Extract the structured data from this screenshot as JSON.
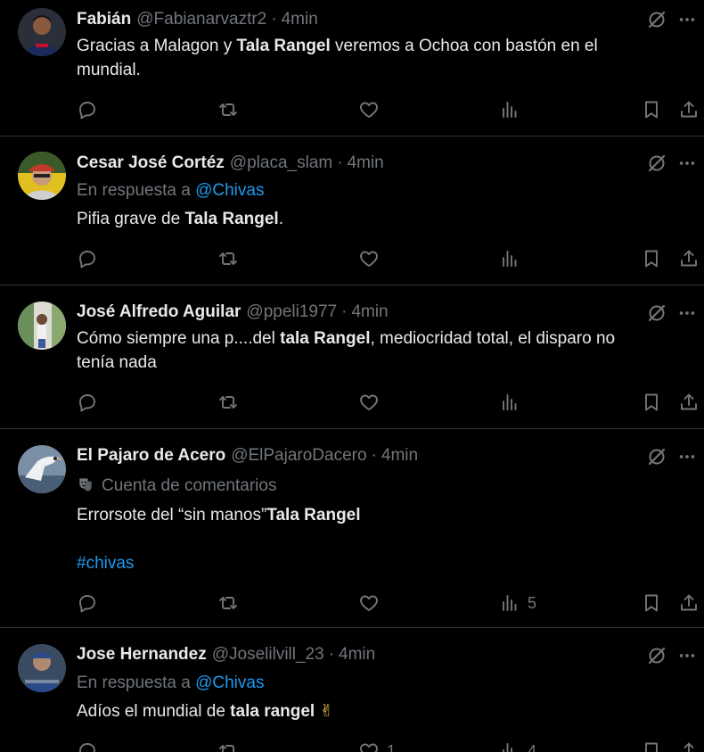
{
  "colors": {
    "background": "#000000",
    "text": "#e7e9ea",
    "muted": "#71767b",
    "link": "#1d9bf0",
    "divider": "#2f3336"
  },
  "icons": {
    "reply": "speech-bubble-icon",
    "repost": "repost-arrows-icon",
    "like": "heart-icon",
    "views": "bar-chart-icon",
    "bookmark": "bookmark-icon",
    "share": "share-upload-icon",
    "grok": "grok-slash-circle-icon",
    "more": "ellipsis-icon",
    "community": "drama-mask-icon"
  },
  "posts": [
    {
      "name": "Fabián",
      "handle": "@Fabianarvaztr2",
      "time": "4min",
      "text_a": "Gracias a Malagon y ",
      "text_b": "Tala Rangel",
      "text_c": " veremos a Ochoa con bastón en el",
      "text_d": "mundial.",
      "avatar_colors": [
        "#1a2a5a",
        "#c8102e"
      ]
    },
    {
      "name": "Cesar José Cortéz",
      "handle": "@placa_slam",
      "time": "4min",
      "reply_prefix": "En respuesta a ",
      "reply_to": "@Chivas",
      "text_a": "Pifia grave de ",
      "text_b": "Tala Rangel",
      "text_c": ".",
      "avatar_colors": [
        "#e0c020",
        "#c0392b"
      ]
    },
    {
      "name": "José Alfredo Aguilar",
      "handle": "@ppeli1977",
      "time": "4min",
      "text_a": "Cómo siempre una p....del ",
      "text_b": "tala Rangel",
      "text_c": ", mediocridad total, el disparo no",
      "text_d": "tenía nada",
      "avatar_colors": [
        "#6a8f5a",
        "#d8d8d0"
      ]
    },
    {
      "name": "El Pajaro de Acero",
      "handle": "@ElPajaroDacero",
      "time": "4min",
      "community": "Cuenta de comentarios",
      "text_a": "Errorsote del “sin manos”",
      "text_b": "Tala Rangel",
      "hashtag": "#chivas",
      "views_count": "5",
      "avatar_colors": [
        "#5a6f85",
        "#e8ecef"
      ]
    },
    {
      "name": "Jose Hernandez",
      "handle": "@Joselilvill_23",
      "time": "4min",
      "reply_prefix": "En respuesta a ",
      "reply_to": "@Chivas",
      "text_a": "Adíos el mundial de ",
      "text_b": "tala rangel",
      "text_c": " ✌",
      "likes_count": "1",
      "views_count": "4",
      "avatar_colors": [
        "#2a4a8a",
        "#7a8aa0"
      ]
    }
  ]
}
